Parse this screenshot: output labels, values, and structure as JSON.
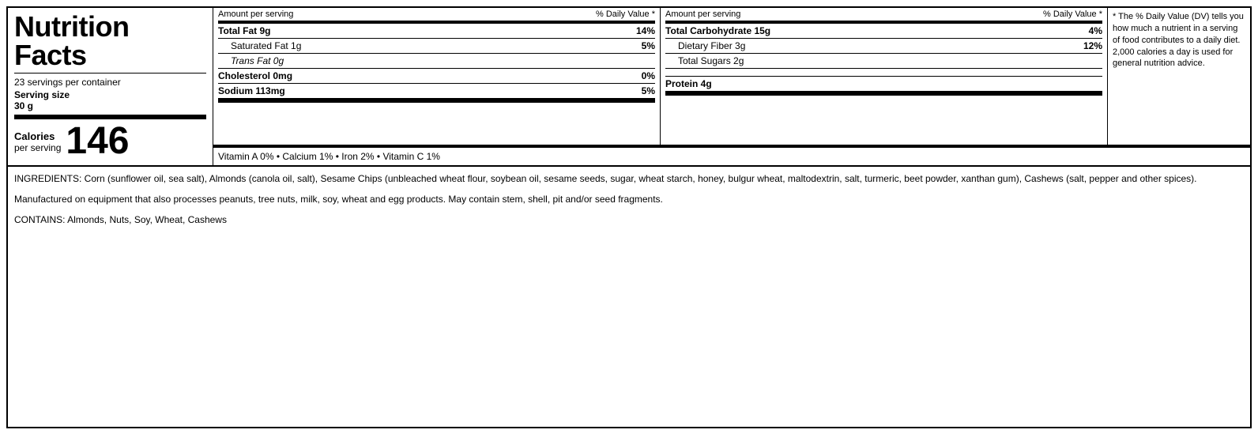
{
  "title": "Nutrition Facts",
  "left": {
    "servings_per_container": "23 servings per container",
    "serving_size_label": "Serving size",
    "serving_size_value": "30 g",
    "calories_label": "Calories",
    "calories_per_serving": "per serving",
    "calories_number": "146"
  },
  "header": {
    "amount_per_serving": "Amount per serving",
    "daily_value": "% Daily Value *"
  },
  "left_nutrients": [
    {
      "label": "Total Fat 9g",
      "bold": true,
      "value": "14%",
      "indented": false
    },
    {
      "label": "Saturated Fat 1g",
      "bold": false,
      "value": "5%",
      "indented": true
    },
    {
      "label": "Trans Fat 0g",
      "bold": false,
      "italic": true,
      "value": "",
      "indented": true
    },
    {
      "label": "Cholesterol 0mg",
      "bold": true,
      "value": "0%",
      "indented": false
    },
    {
      "label": "Sodium 113mg",
      "bold": true,
      "value": "5%",
      "indented": false,
      "thick_bottom": true
    }
  ],
  "right_nutrients": [
    {
      "label": "Total Carbohydrate 15g",
      "bold": true,
      "value": "4%",
      "indented": false
    },
    {
      "label": "Dietary Fiber 3g",
      "bold": false,
      "value": "12%",
      "indented": true
    },
    {
      "label": "Total Sugars 2g",
      "bold": false,
      "value": "",
      "indented": true
    },
    {
      "label": "Protein 4g",
      "bold": true,
      "value": "",
      "indented": false,
      "thick_bottom": true
    }
  ],
  "vitamins": "Vitamin A  0%  •  Calcium  1%  •  Iron  2%  •  Vitamin C  1%",
  "footnote": "* The % Daily Value (DV) tells you how much a nutrient in a serving of food contributes to a daily diet. 2,000 calories a day is used for general nutrition advice.",
  "ingredients": "INGREDIENTS: Corn (sunflower oil, sea salt), Almonds (canola oil, salt), Sesame Chips (unbleached wheat flour, soybean oil, sesame seeds, sugar, wheat starch, honey, bulgur wheat, maltodextrin, salt, turmeric, beet powder, xanthan gum), Cashews (salt, pepper and other spices).",
  "manufactured": "Manufactured on equipment that also processes peanuts, tree nuts, milk, soy, wheat and egg products.  May contain stem, shell, pit and/or seed fragments.",
  "contains": "CONTAINS: Almonds, Nuts, Soy, Wheat, Cashews"
}
